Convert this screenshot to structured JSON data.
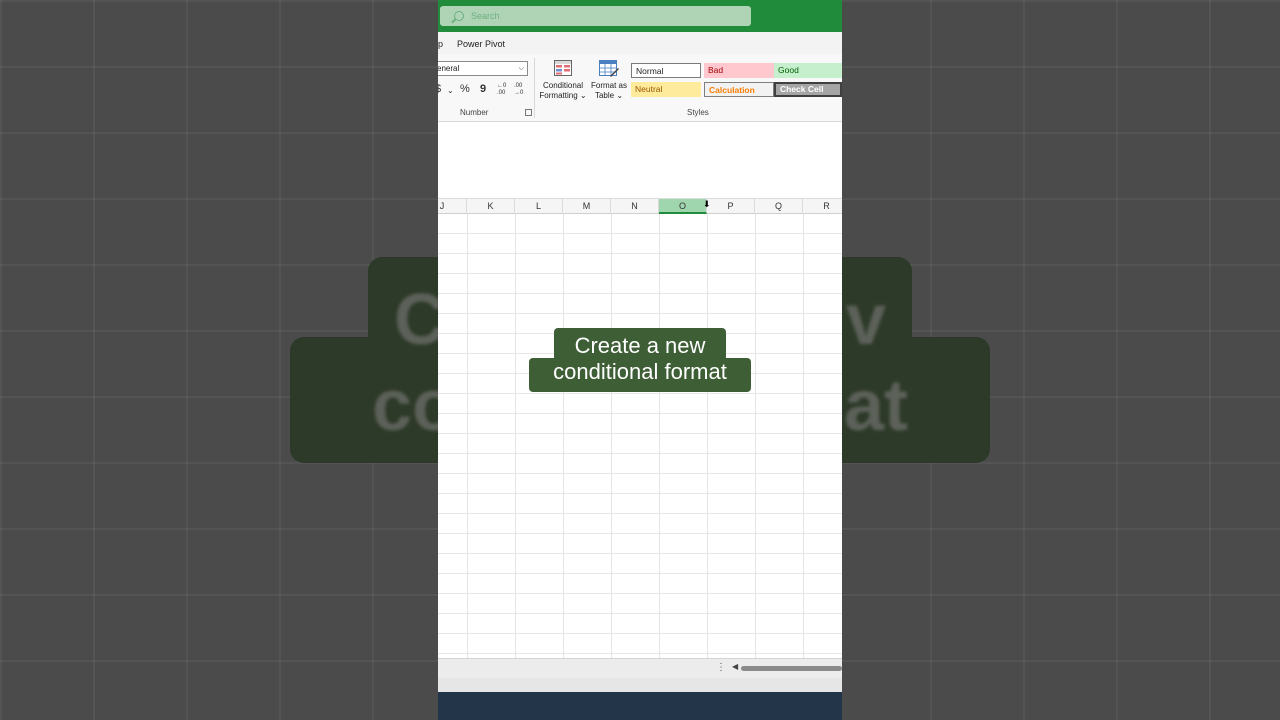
{
  "search": {
    "placeholder": "Search"
  },
  "menu": {
    "partial_tab": "p",
    "power_pivot": "Power Pivot"
  },
  "number_group": {
    "format_value": "eneral",
    "currency": "$",
    "percent": "%",
    "comma": "9",
    "inc_decimal_top": "←0",
    "inc_decimal_bottom": ".00",
    "dec_decimal_top": ".00",
    "dec_decimal_bottom": "→0",
    "label": "Number"
  },
  "conditional_formatting": {
    "line1": "Conditional",
    "line2": "Formatting"
  },
  "format_as_table": {
    "line1": "Format as",
    "line2": "Table"
  },
  "styles": {
    "normal": "Normal",
    "bad": "Bad",
    "good": "Good",
    "neutral": "Neutral",
    "calculation": "Calculation",
    "check_cell": "Check Cell",
    "label": "Styles"
  },
  "columns": [
    "J",
    "K",
    "L",
    "M",
    "N",
    "O",
    "P",
    "Q",
    "R"
  ],
  "selected_column": "O",
  "caption": {
    "line1": "Create a new",
    "line2": "conditional format"
  },
  "background_caption": {
    "line1": "C                    v",
    "line2": "con              mat"
  },
  "status": {
    "more": "⋮",
    "scroll_left": "◀"
  },
  "colors": {
    "accent": "#1f8b3b",
    "caption_bg": "#3e5e36",
    "selected_col": "#9fd6ae"
  }
}
